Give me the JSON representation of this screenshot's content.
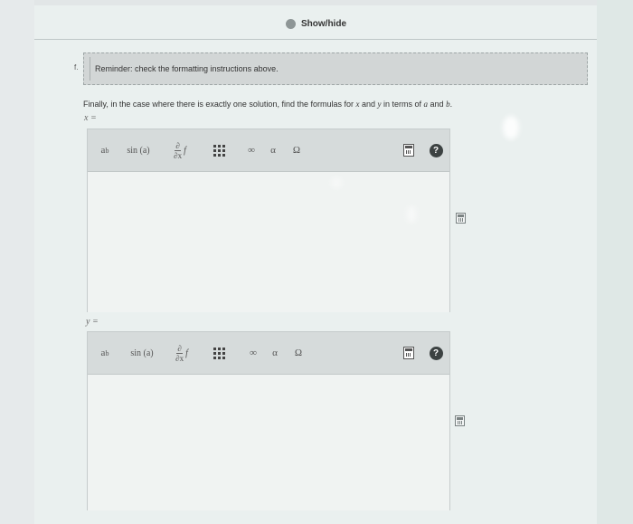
{
  "header": {
    "show_hide_label": "Show/hide"
  },
  "question": {
    "number": "f.",
    "reminder": "Reminder: check the formatting instructions above.",
    "instruction_prefix": "Finally, in the case where there is exactly one solution, find the formulas for ",
    "var_x": "x",
    "instruction_mid": " and ",
    "var_y": "y",
    "instruction_mid2": " in terms of ",
    "var_a": "a",
    "instruction_mid3": " and ",
    "var_b": "b",
    "instruction_suffix": "."
  },
  "answers": [
    {
      "label": "x =",
      "value": ""
    },
    {
      "label": "y =",
      "value": ""
    }
  ],
  "toolbar": {
    "power_base": "a",
    "power_exp": "b",
    "sin_label": "sin (a)",
    "partial_num": "∂",
    "partial_den": "∂x",
    "partial_f": "f",
    "infinity": "∞",
    "alpha": "α",
    "omega": "Ω",
    "help": "?"
  }
}
